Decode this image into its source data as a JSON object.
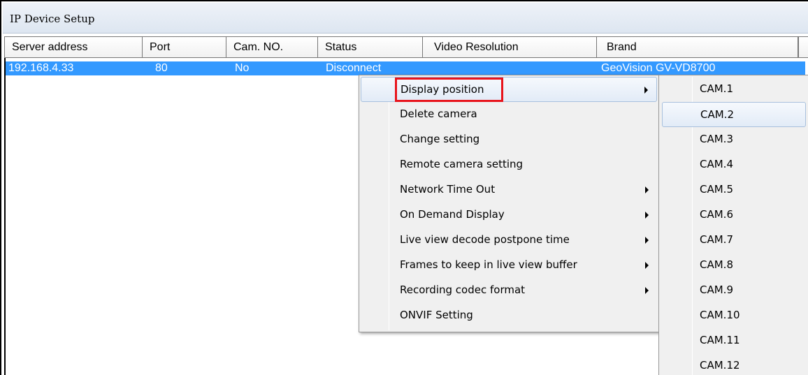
{
  "window": {
    "title": "IP Device Setup"
  },
  "table": {
    "columns": [
      "Server address",
      "Port",
      "Cam. NO.",
      "Status",
      "Video Resolution",
      "Brand"
    ],
    "rows": [
      {
        "server_address": "192.168.4.33",
        "port": "80",
        "cam_no": "No",
        "status": "Disconnect",
        "video_resolution": "",
        "brand": "GeoVision  GV-VD8700"
      }
    ],
    "selected_row_color": "#3399ff"
  },
  "context_menu": {
    "items": [
      {
        "label": "Display position",
        "has_submenu": true,
        "highlighted": true
      },
      {
        "label": "Delete camera",
        "has_submenu": false
      },
      {
        "label": "Change setting",
        "has_submenu": false
      },
      {
        "label": "Remote camera setting",
        "has_submenu": false
      },
      {
        "label": "Network Time Out",
        "has_submenu": true
      },
      {
        "label": "On Demand Display",
        "has_submenu": true
      },
      {
        "label": "Live view decode postpone time",
        "has_submenu": true
      },
      {
        "label": "Frames to keep in live view buffer",
        "has_submenu": true
      },
      {
        "label": "Recording codec format",
        "has_submenu": true
      },
      {
        "label": "ONVIF Setting",
        "has_submenu": false
      }
    ],
    "annotation_color": "#e8141c"
  },
  "submenu": {
    "items": [
      "CAM.1",
      "CAM.2",
      "CAM.3",
      "CAM.4",
      "CAM.5",
      "CAM.6",
      "CAM.7",
      "CAM.8",
      "CAM.9",
      "CAM.10",
      "CAM.11",
      "CAM.12"
    ],
    "hovered": "CAM.2"
  }
}
